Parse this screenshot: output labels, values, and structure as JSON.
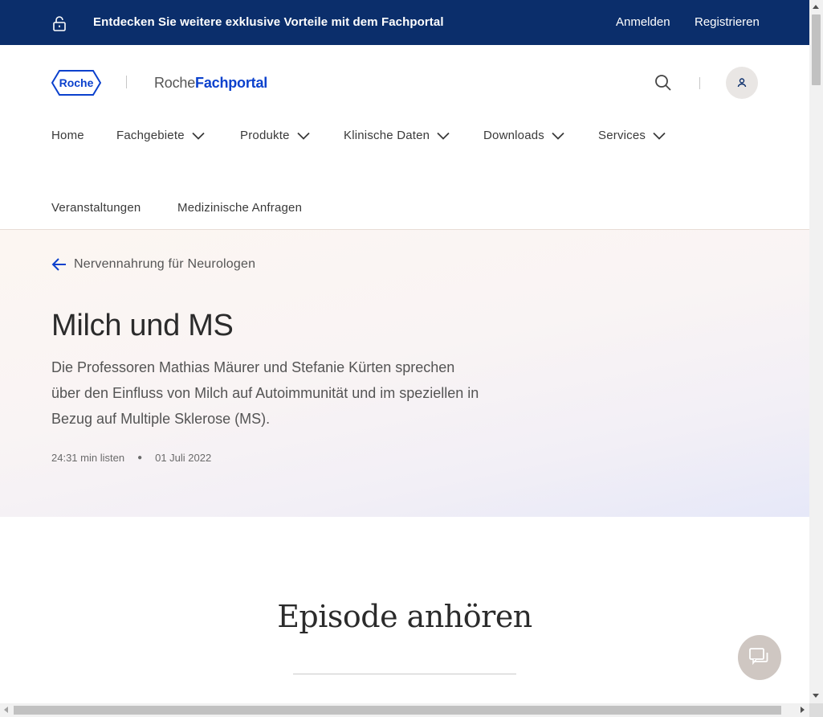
{
  "topbar": {
    "promo": "Entdecken Sie weitere exklusive Vorteile mit dem Fachportal",
    "login": "Anmelden",
    "register": "Registrieren",
    "bg_color": "#0b2e6b"
  },
  "header": {
    "logo_text": "Roche",
    "brand_prefix": "Roche",
    "brand_suffix": "Fachportal",
    "accent_color": "#0b41cd"
  },
  "nav": {
    "items": [
      {
        "label": "Home"
      },
      {
        "label": "Fachgebiete"
      },
      {
        "label": "Produkte"
      },
      {
        "label": "Klinische Daten"
      },
      {
        "label": "Downloads"
      },
      {
        "label": "Services"
      }
    ],
    "row2": [
      {
        "label": "Veranstaltungen"
      },
      {
        "label": "Medizinische Anfragen"
      }
    ]
  },
  "hero": {
    "back_label": "Nervennahrung für Neurologen",
    "title": "Milch und MS",
    "description": "Die Professoren Mathias Mäurer und Stefanie Kürten sprechen über den Einfluss von Milch auf Autoimmunität und im speziellen in Bezug auf Multiple Sklerose (MS).",
    "duration": "24:31 min listen",
    "date": "01 Juli 2022"
  },
  "episode": {
    "title": "Episode anhören"
  }
}
